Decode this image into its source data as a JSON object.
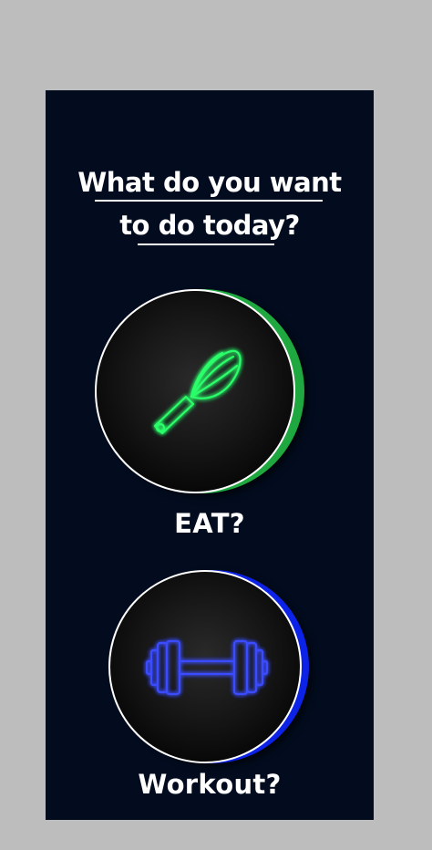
{
  "prompt": {
    "line1": "What do you want",
    "line2": "to do today?"
  },
  "options": [
    {
      "label": "EAT?",
      "icon": "whisk-icon",
      "accent": "#1fd14a"
    },
    {
      "label": "Workout?",
      "icon": "dumbbell-icon",
      "accent": "#1a2cff"
    }
  ],
  "colors": {
    "page_background": "#bdbdbd",
    "panel_background": "#020c1e",
    "text": "#ffffff"
  }
}
